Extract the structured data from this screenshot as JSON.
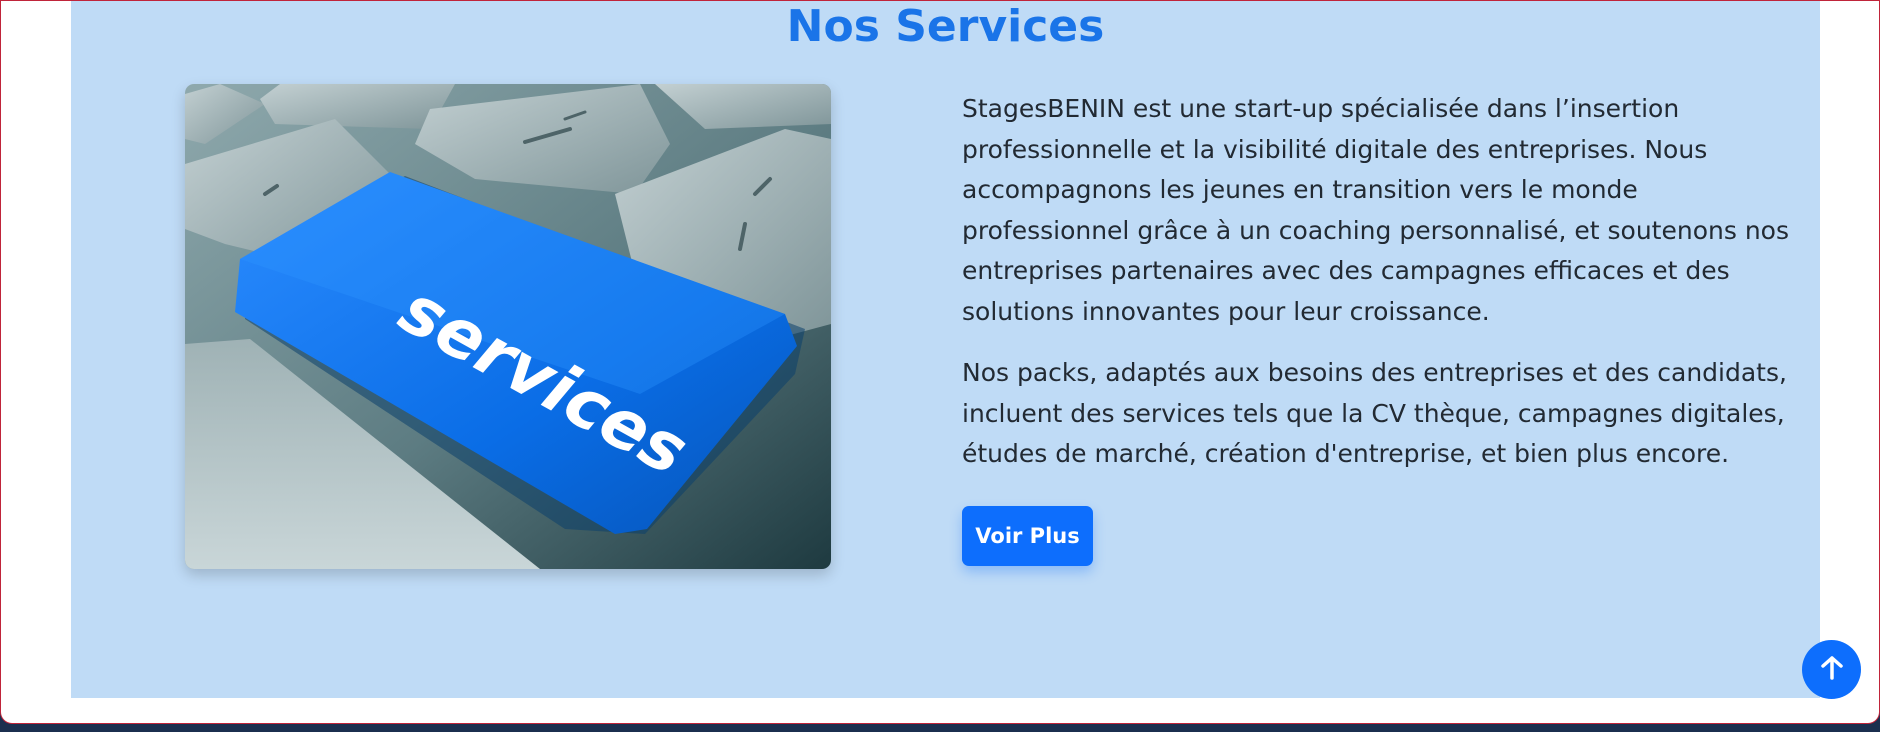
{
  "section": {
    "title": "Nos Services",
    "image_alt": "services",
    "image_key_label": "services",
    "paragraphs": [
      "StagesBENIN est une start-up spécialisée dans l’insertion professionnelle et la visibilité digitale des entreprises. Nous accompagnons les jeunes en transition vers le monde professionnel grâce à un coaching personnalisé, et soutenons nos entreprises partenaires avec des campagnes efficaces et des solutions innovantes pour leur croissance.",
      "Nos packs, adaptés aux besoins des entreprises et des candidats, incluent des services tels que la CV thèque, campagnes digitales, études de marché, création d'entreprise, et bien plus encore."
    ],
    "button_label": "Voir Plus"
  },
  "back_to_top": {
    "icon": "arrow-up-icon"
  },
  "colors": {
    "section_bg": "#bfdbf6",
    "title": "#1a74e8",
    "button": "#0d6efd",
    "body_text": "#222a33"
  }
}
